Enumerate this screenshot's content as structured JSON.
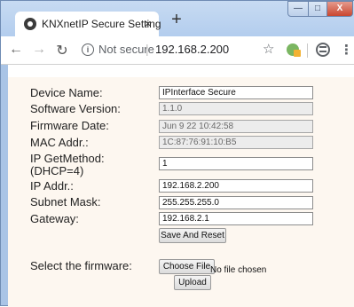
{
  "browser": {
    "tab_title": "KNXnetIP Secure Setting",
    "tab_close": "×",
    "new_tab": "+",
    "security_label": "Not secure",
    "url_separator": "|",
    "url": "192.168.2.200",
    "window_controls": {
      "minimize": "—",
      "maximize": "□",
      "close": "X"
    }
  },
  "form": {
    "device_name": {
      "label": "Device Name:",
      "value": "IPInterface Secure"
    },
    "software_version": {
      "label": "Software Version:",
      "value": "1.1.0"
    },
    "firmware_date": {
      "label": "Firmware Date:",
      "value": "Jun  9 22 10:42:58"
    },
    "mac_addr": {
      "label": "MAC Addr.:",
      "value": "1C:87:76:91:10:B5"
    },
    "ip_getmethod": {
      "label_line1": "IP GetMethod:",
      "label_line2": "(DHCP=4)",
      "value": "1"
    },
    "ip_addr": {
      "label": "IP Addr.:",
      "value": "192.168.2.200"
    },
    "subnet_mask": {
      "label": "Subnet Mask:",
      "value": "255.255.255.0"
    },
    "gateway": {
      "label": "Gateway:",
      "value": "192.168.2.1"
    },
    "save_button": "Save And Reset"
  },
  "firmware": {
    "label": "Select the firmware:",
    "choose_file_button": "Choose File",
    "no_file_text": "No file chosen",
    "upload_button": "Upload"
  },
  "icons": {
    "favicon": "globe-icon",
    "back": "back-arrow-icon",
    "forward": "forward-arrow-icon",
    "reload": "reload-icon",
    "info": "info-icon",
    "star": "star-icon",
    "extension": "extension-icon",
    "profile": "profile-icon",
    "menu": "kebab-menu-icon"
  }
}
